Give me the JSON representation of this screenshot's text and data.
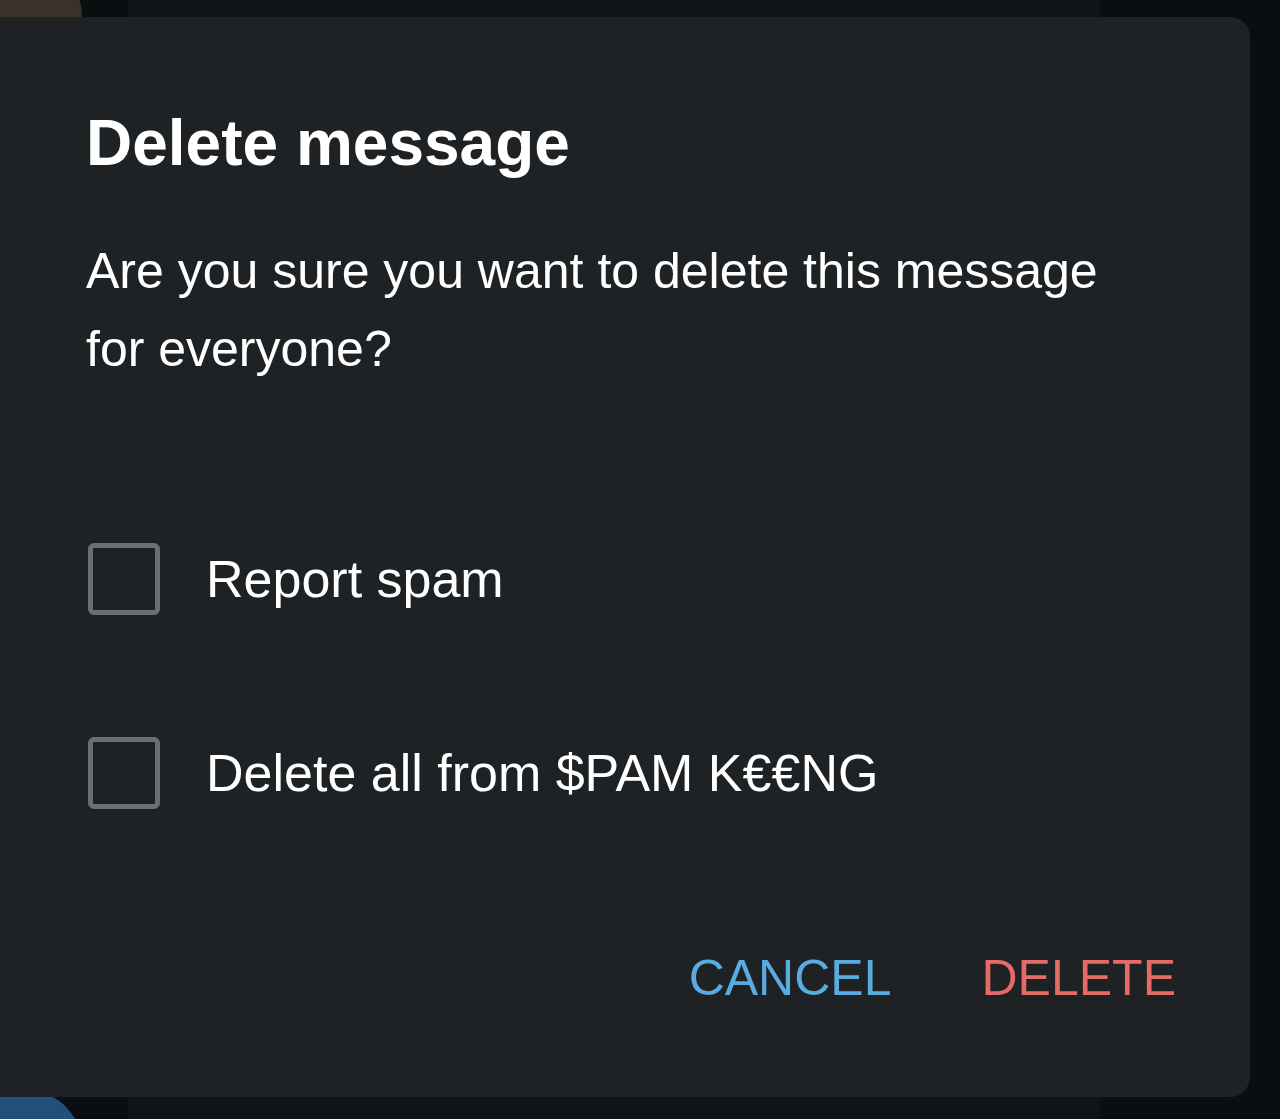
{
  "dialog": {
    "title": "Delete message",
    "message": "Are you sure you want to delete this message for everyone?",
    "options": [
      {
        "label": "Report spam",
        "checked": false
      },
      {
        "label": "Delete all from $PAM K€€NG",
        "checked": false
      }
    ],
    "buttons": [
      {
        "label": "CANCEL",
        "kind": "neutral"
      },
      {
        "label": "DELETE",
        "kind": "destructive"
      }
    ]
  }
}
